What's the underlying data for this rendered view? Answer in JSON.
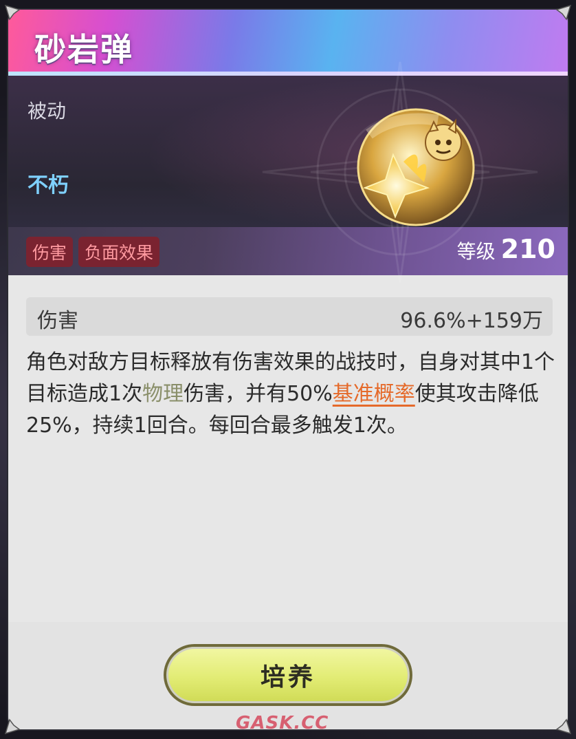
{
  "title": "砂岩弹",
  "skill": {
    "type_label": "被动",
    "path_label": "不朽",
    "tags": [
      "伤害",
      "负面效果"
    ],
    "level_label": "等级",
    "level_value": "210"
  },
  "stat": {
    "name": "伤害",
    "value": "96.6%+159万"
  },
  "description": {
    "part1": "角色对敌方目标释放有伤害效果的战技时，自身对其中1个目标造成1次",
    "kw1": "物理",
    "part2": "伤害，并有50%",
    "kw2": "基准概率",
    "part3": "使其攻击降低25%，持续1回合。每回合最多触发1次。"
  },
  "button": {
    "label": "培养"
  },
  "watermark": "GASK.CC",
  "colors": {
    "accent_tag": "#7a2330",
    "keyword_physical": "#8a8f6a",
    "keyword_base": "#e56a2a",
    "button": "#e2ec74"
  },
  "icons": [
    "compass-emblem-icon",
    "skill-icon",
    "corner-ornament-icon"
  ]
}
